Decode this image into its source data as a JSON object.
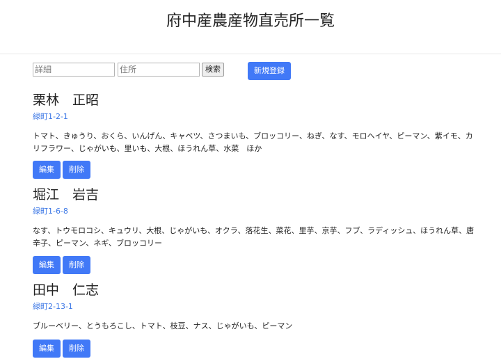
{
  "page": {
    "title": "府中産農産物直売所一覧"
  },
  "search": {
    "detail_placeholder": "詳細",
    "address_placeholder": "住所",
    "search_label": "検索",
    "new_label": "新規登録"
  },
  "entries": [
    {
      "name": "栗林　正昭",
      "address": "緑町1-2-1",
      "crops": "トマト、きゅうり、おくら、いんげん、キャベツ、さつまいも、ブロッコリー、ねぎ、なす、モロヘイヤ、ピーマン、紫イモ、カリフラワー、じゃがいも、里いも、大根、ほうれん草、水菜　ほか",
      "edit_label": "編集",
      "delete_label": "削除"
    },
    {
      "name": "堀江　岩吉",
      "address": "緑町1-6-8",
      "crops": "なす、トウモロコシ、キュウリ、大根、じゃがいも、オクラ、落花生、菜花、里芋、京芋、フブ、ラディッシュ、ほうれん草、唐辛子、ピーマン、ネギ、ブロッコリー",
      "edit_label": "編集",
      "delete_label": "削除"
    },
    {
      "name": "田中　仁志",
      "address": "緑町2-13-1",
      "crops": "ブルーベリー、とうもろこし、トマト、枝豆、ナス、じゃがいも、ピーマン",
      "edit_label": "編集",
      "delete_label": "削除"
    }
  ],
  "colors": {
    "accent": "#4179f7",
    "link": "#3d78e6"
  }
}
